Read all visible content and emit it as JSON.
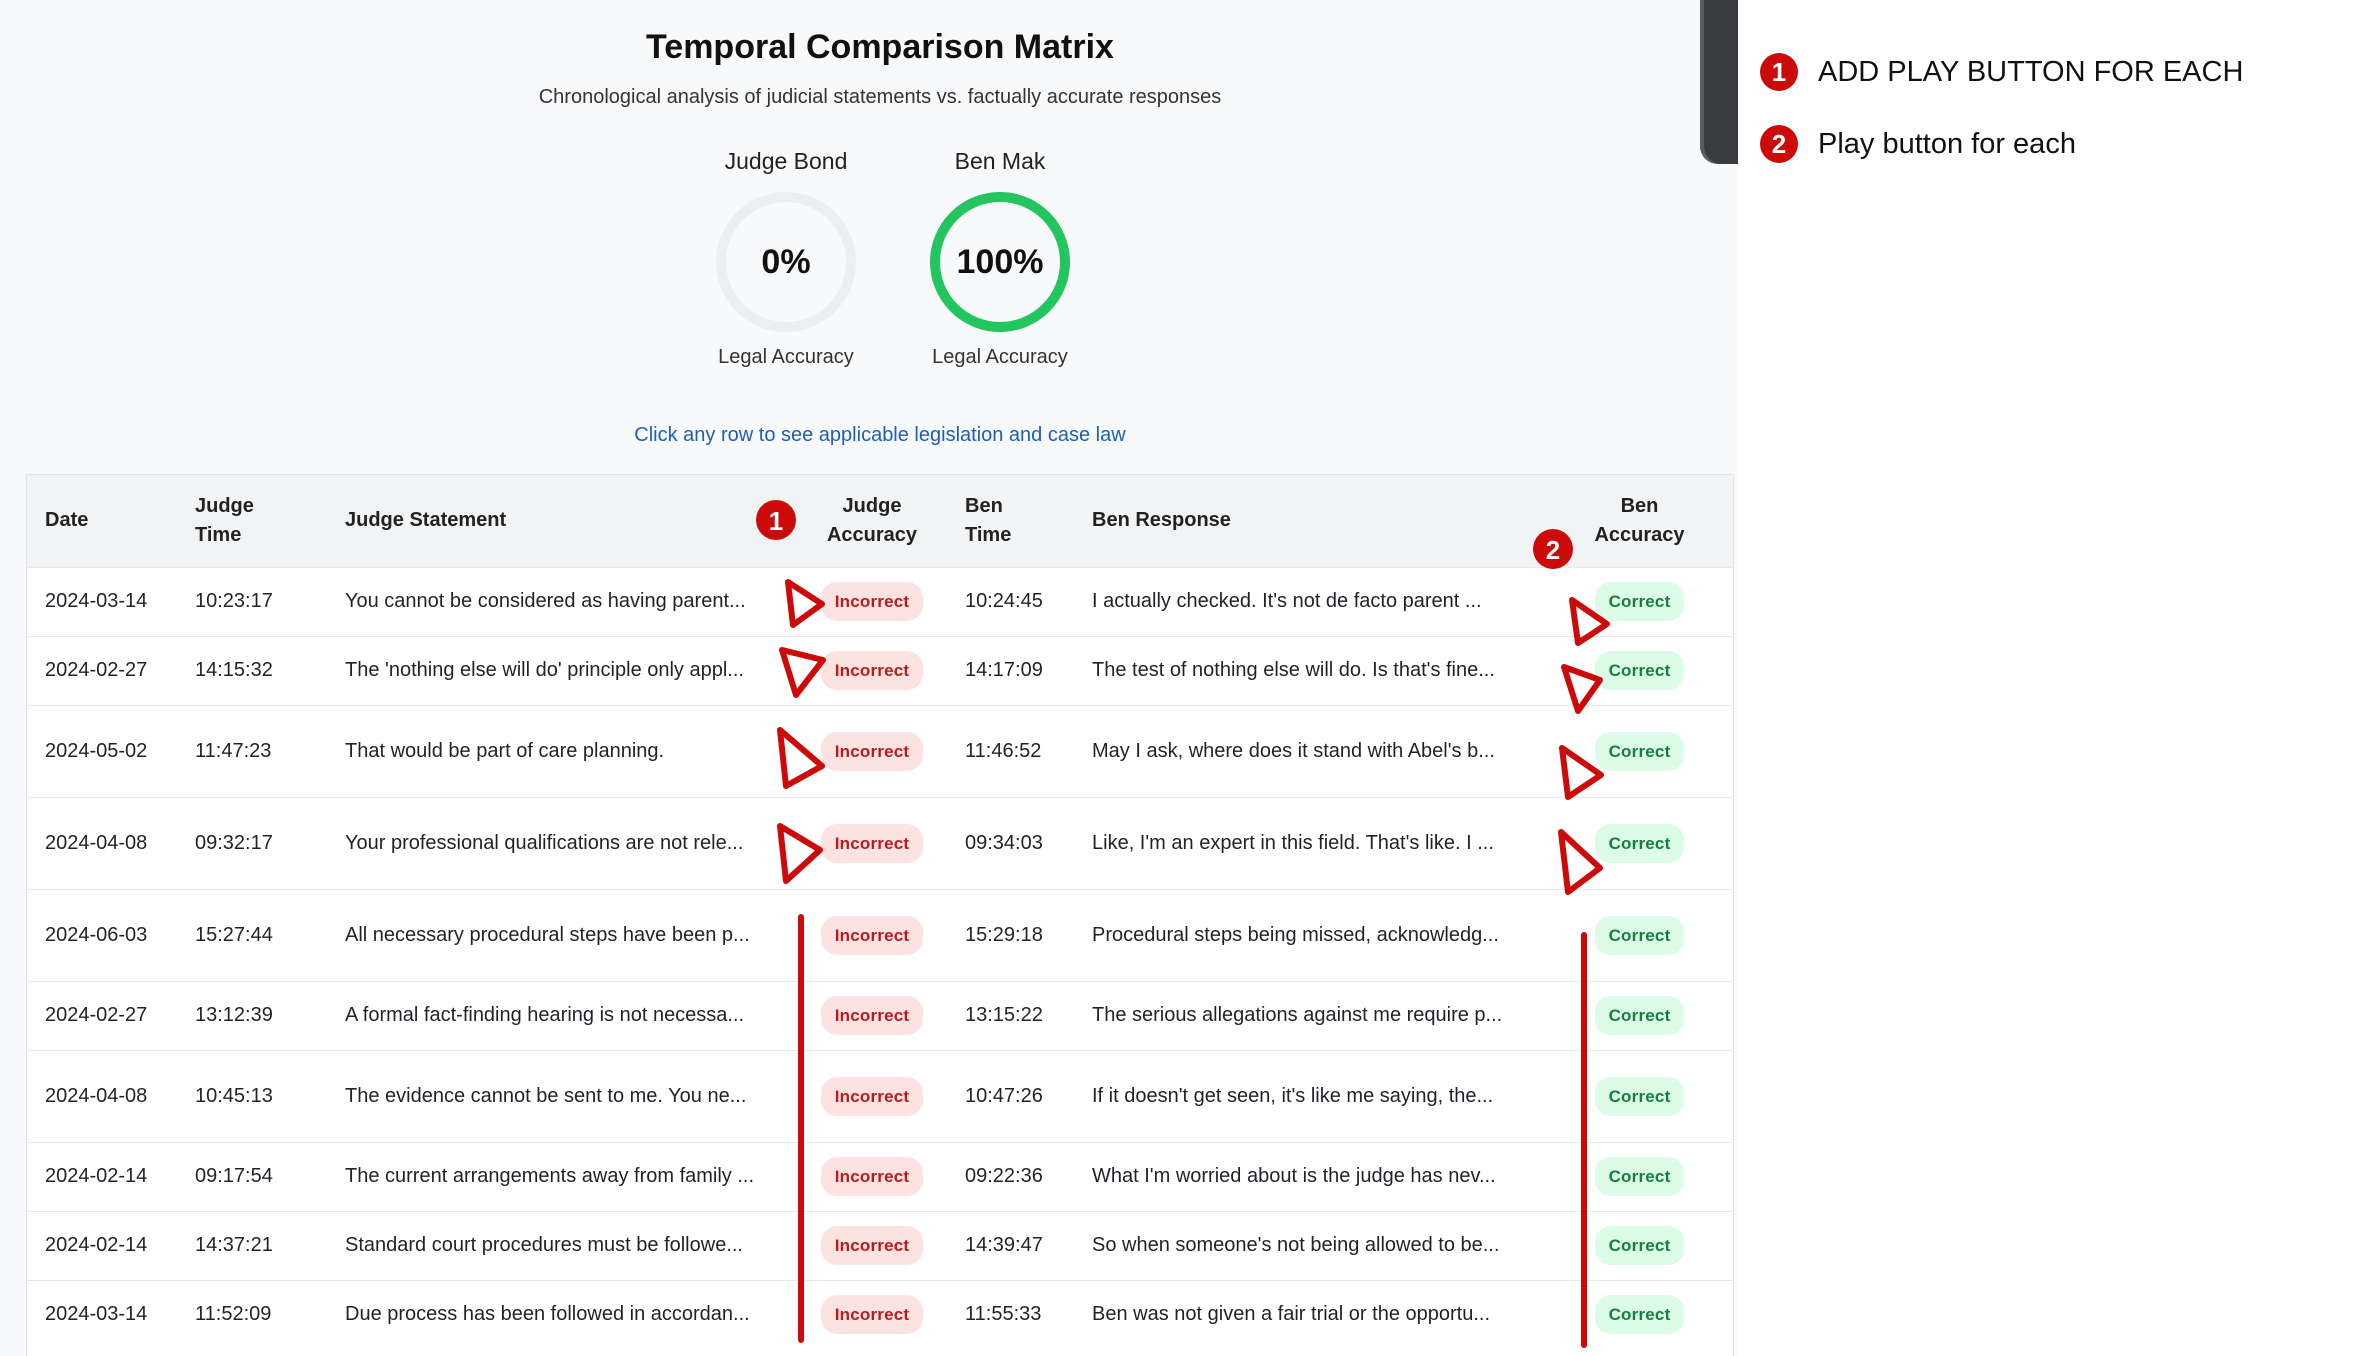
{
  "header": {
    "title": "Temporal Comparison Matrix",
    "subtitle": "Chronological analysis of judicial statements vs. factually accurate responses"
  },
  "gauges": [
    {
      "name": "Judge Bond",
      "value": "0%",
      "caption": "Legal Accuracy",
      "fraction": 0.0
    },
    {
      "name": "Ben Mak",
      "value": "100%",
      "caption": "Legal Accuracy",
      "fraction": 1.0
    }
  ],
  "hint": "Click any row to see applicable legislation and case law",
  "table": {
    "headers": {
      "date": "Date",
      "judge_time_1": "Judge",
      "judge_time_2": "Time",
      "judge_statement": "Judge Statement",
      "judge_accuracy_1": "Judge",
      "judge_accuracy_2": "Accuracy",
      "ben_time_1": "Ben",
      "ben_time_2": "Time",
      "ben_response": "Ben Response",
      "ben_accuracy_1": "Ben",
      "ben_accuracy_2": "Accuracy"
    },
    "rows": [
      {
        "date": "2024-03-14",
        "judge_time": "10:23:17",
        "judge_statement": "You cannot be considered as having parent...",
        "judge_accuracy": "Incorrect",
        "ben_time": "10:24:45",
        "ben_response": "I actually checked. It's not de facto parent ...",
        "ben_accuracy": "Correct"
      },
      {
        "date": "2024-02-27",
        "judge_time": "14:15:32",
        "judge_statement": "The 'nothing else will do' principle only appl...",
        "judge_accuracy": "Incorrect",
        "ben_time": "14:17:09",
        "ben_response": "The test of nothing else will do. Is that's fine...",
        "ben_accuracy": "Correct"
      },
      {
        "date": "2024-05-02",
        "judge_time": "11:47:23",
        "judge_statement": "That would be part of care planning.",
        "judge_accuracy": "Incorrect",
        "ben_time": "11:46:52",
        "ben_response": "May I ask, where does it stand with Abel's b...",
        "ben_accuracy": "Correct"
      },
      {
        "date": "2024-04-08",
        "judge_time": "09:32:17",
        "judge_statement": "Your professional qualifications are not rele...",
        "judge_accuracy": "Incorrect",
        "ben_time": "09:34:03",
        "ben_response": "Like, I'm an expert in this field. That's like. I ...",
        "ben_accuracy": "Correct"
      },
      {
        "date": "2024-06-03",
        "judge_time": "15:27:44",
        "judge_statement": "All necessary procedural steps have been p...",
        "judge_accuracy": "Incorrect",
        "ben_time": "15:29:18",
        "ben_response": "Procedural steps being missed, acknowledg...",
        "ben_accuracy": "Correct"
      },
      {
        "date": "2024-02-27",
        "judge_time": "13:12:39",
        "judge_statement": "A formal fact-finding hearing is not necessa...",
        "judge_accuracy": "Incorrect",
        "ben_time": "13:15:22",
        "ben_response": "The serious allegations against me require p...",
        "ben_accuracy": "Correct"
      },
      {
        "date": "2024-04-08",
        "judge_time": "10:45:13",
        "judge_statement": "The evidence cannot be sent to me. You ne...",
        "judge_accuracy": "Incorrect",
        "ben_time": "10:47:26",
        "ben_response": "If it doesn't get seen, it's like me saying, the...",
        "ben_accuracy": "Correct"
      },
      {
        "date": "2024-02-14",
        "judge_time": "09:17:54",
        "judge_statement": "The current arrangements away from family ...",
        "judge_accuracy": "Incorrect",
        "ben_time": "09:22:36",
        "ben_response": "What I'm worried about is the judge has nev...",
        "ben_accuracy": "Correct"
      },
      {
        "date": "2024-02-14",
        "judge_time": "14:37:21",
        "judge_statement": "Standard court procedures must be followe...",
        "judge_accuracy": "Incorrect",
        "ben_time": "14:39:47",
        "ben_response": "So when someone's not being allowed to be...",
        "ben_accuracy": "Correct"
      },
      {
        "date": "2024-03-14",
        "judge_time": "11:52:09",
        "judge_statement": "Due process has been followed in accordan...",
        "judge_accuracy": "Incorrect",
        "ben_time": "11:55:33",
        "ben_response": "Ben was not given a fair trial or the opportu...",
        "ben_accuracy": "Correct"
      }
    ]
  },
  "annotations": {
    "marker_color": "#cc0a0a",
    "markers": [
      "1",
      "2"
    ],
    "notes": [
      {
        "num": "1",
        "text": "ADD PLAY BUTTON FOR EACH"
      },
      {
        "num": "2",
        "text": "Play button for each"
      }
    ]
  }
}
